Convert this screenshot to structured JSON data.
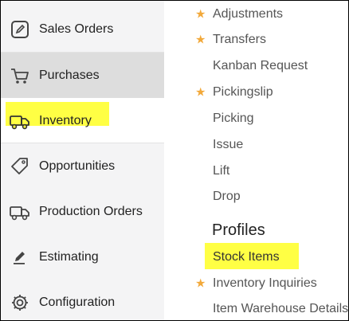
{
  "sidebar": {
    "items": [
      {
        "label": "Sales Orders",
        "icon": "edit-icon"
      },
      {
        "label": "Purchases",
        "icon": "cart-icon"
      },
      {
        "label": "Inventory",
        "icon": "truck-icon"
      },
      {
        "label": "Opportunities",
        "icon": "tag-icon"
      },
      {
        "label": "Production Orders",
        "icon": "truck-icon"
      },
      {
        "label": "Estimating",
        "icon": "pencil-icon"
      },
      {
        "label": "Configuration",
        "icon": "gear-icon"
      }
    ]
  },
  "panel": {
    "items": [
      {
        "label": "Adjustments",
        "starred": true
      },
      {
        "label": "Transfers",
        "starred": true
      },
      {
        "label": "Kanban Request",
        "starred": false
      },
      {
        "label": "Pickingslip",
        "starred": true
      },
      {
        "label": "Picking",
        "starred": false
      },
      {
        "label": "Issue",
        "starred": false
      },
      {
        "label": "Lift",
        "starred": false
      },
      {
        "label": "Drop",
        "starred": false
      }
    ],
    "profiles_heading": "Profiles",
    "profile_items": [
      {
        "label": "Stock Items",
        "starred": false
      },
      {
        "label": "Inventory Inquiries",
        "starred": true
      },
      {
        "label": "Item Warehouse Details",
        "starred": false
      }
    ]
  },
  "colors": {
    "highlight": "#ffff44",
    "star": "#f2a93b",
    "sidebar_bg": "#f4f4f5",
    "selected_bg": "#dddddd"
  }
}
